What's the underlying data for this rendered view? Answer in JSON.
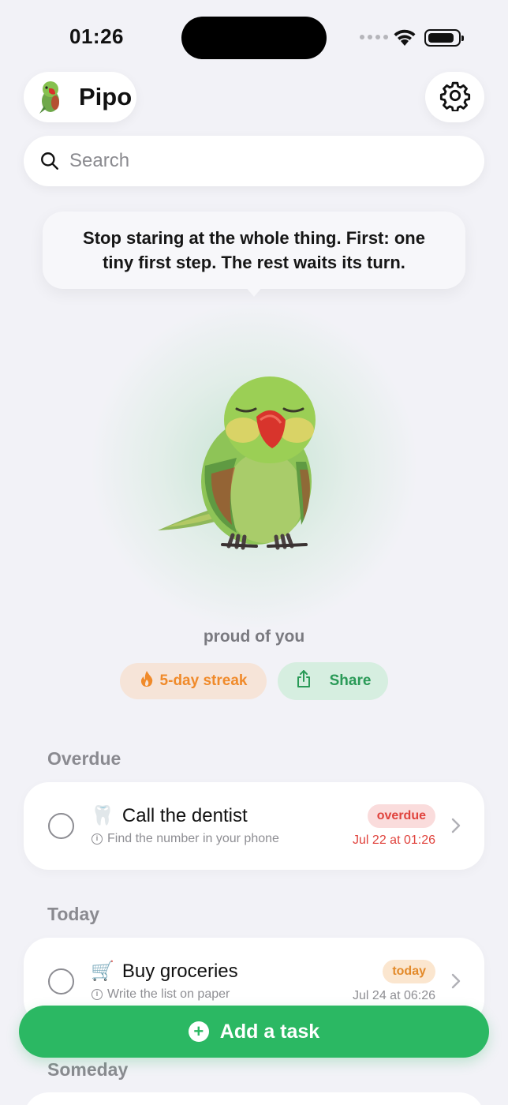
{
  "status_bar": {
    "time": "01:26",
    "battery_level": 0.9
  },
  "header": {
    "app_name": "Pipo",
    "avatar_icon": "parrot-icon",
    "settings_icon": "gear-icon"
  },
  "search": {
    "placeholder": "Search",
    "value": ""
  },
  "mascot": {
    "speech": "Stop staring at the whole thing. First: one tiny first step. The rest waits its turn.",
    "mood": "proud of you"
  },
  "actions": {
    "streak_label": "5-day streak",
    "share_label": "Share"
  },
  "sections": {
    "overdue": {
      "title": "Overdue",
      "task": {
        "emoji": "🦷",
        "title": "Call the dentist",
        "subtitle": "Find the number in your phone",
        "badge": "overdue",
        "due": "Jul 22 at 01:26"
      }
    },
    "today": {
      "title": "Today",
      "task": {
        "emoji": "🛒",
        "title": "Buy groceries",
        "subtitle": "Write the list on paper",
        "badge": "today",
        "due": "Jul 24 at 06:26"
      }
    },
    "someday": {
      "title": "Someday"
    }
  },
  "add_button": {
    "label": "Add a task"
  },
  "colors": {
    "accent": "#2bb863",
    "overdue": "#e0433d",
    "today": "#e38a2a",
    "streak": "#f08a2a"
  }
}
